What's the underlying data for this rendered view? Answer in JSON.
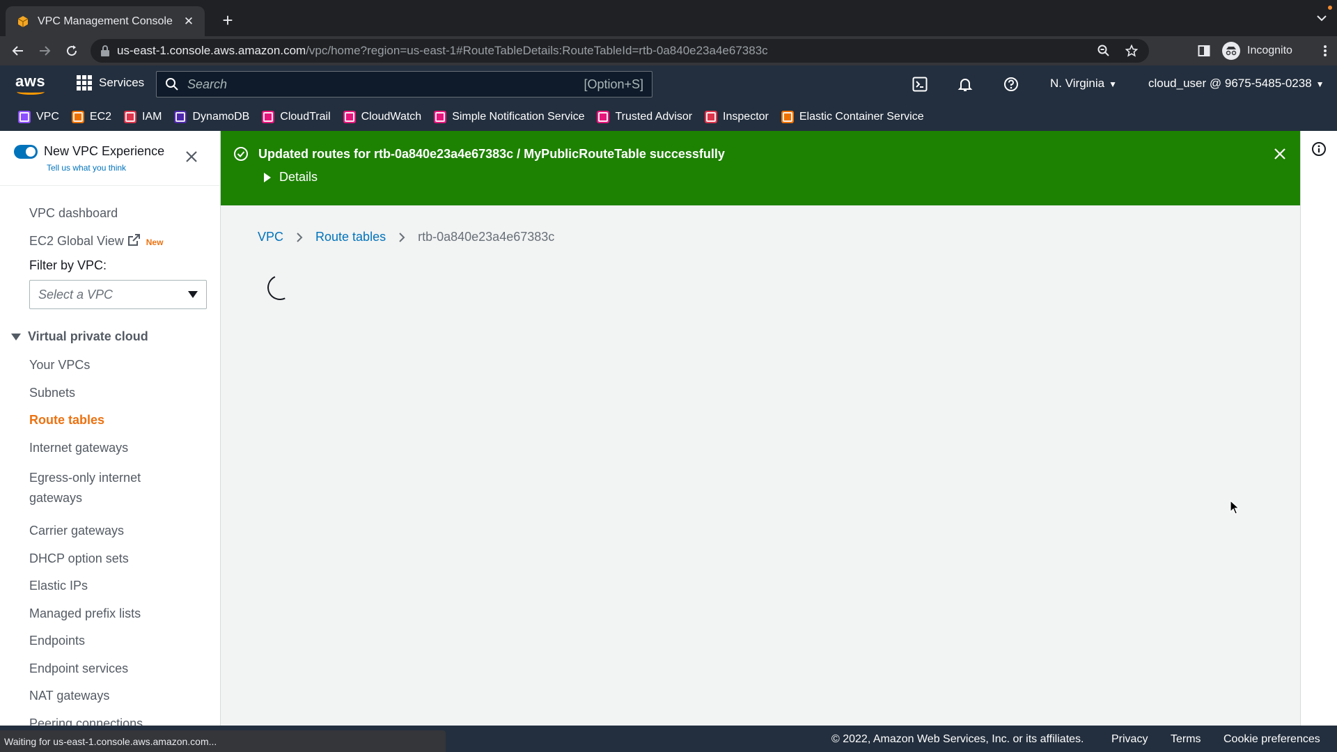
{
  "browser": {
    "tab_title": "VPC Management Console",
    "url_host": "us-east-1.console.aws.amazon.com",
    "url_path": "/vpc/home?region=us-east-1#RouteTableDetails:RouteTableId=rtb-0a840e23a4e67383c",
    "profile_label": "Incognito",
    "status_text": "Waiting for us-east-1.console.aws.amazon.com..."
  },
  "aws_header": {
    "logo": "aws",
    "services_label": "Services",
    "search_placeholder": "Search",
    "search_shortcut": "[Option+S]",
    "region": "N. Virginia",
    "account": "cloud_user @ 9675-5485-0238"
  },
  "favorites": [
    {
      "label": "VPC",
      "color": "#8c4fff"
    },
    {
      "label": "EC2",
      "color": "#ed7100"
    },
    {
      "label": "IAM",
      "color": "#dd344c"
    },
    {
      "label": "DynamoDB",
      "color": "#4d27aa"
    },
    {
      "label": "CloudTrail",
      "color": "#e7157b"
    },
    {
      "label": "CloudWatch",
      "color": "#e7157b"
    },
    {
      "label": "Simple Notification Service",
      "color": "#e7157b"
    },
    {
      "label": "Trusted Advisor",
      "color": "#e7157b"
    },
    {
      "label": "Inspector",
      "color": "#dd344c"
    },
    {
      "label": "Elastic Container Service",
      "color": "#ed7100"
    }
  ],
  "sidebar": {
    "experience_title": "New VPC Experience",
    "experience_link": "Tell us what you think",
    "top_links": {
      "dashboard": "VPC dashboard",
      "global_view": "EC2 Global View",
      "new_badge": "New"
    },
    "filter_label": "Filter by VPC:",
    "filter_value": "Select a VPC",
    "section_title": "Virtual private cloud",
    "items": {
      "your_vpcs": "Your VPCs",
      "subnets": "Subnets",
      "route_tables": "Route tables",
      "internet_gateways": "Internet gateways",
      "egress_line1": "Egress-only internet",
      "egress_line2": "gateways",
      "carrier_gateways": "Carrier gateways",
      "dhcp": "DHCP option sets",
      "elastic_ips": "Elastic IPs",
      "prefix_lists": "Managed prefix lists",
      "endpoints": "Endpoints",
      "endpoint_services": "Endpoint services",
      "nat_gateways": "NAT gateways",
      "peering": "Peering connections"
    }
  },
  "flash": {
    "message": "Updated routes for rtb-0a840e23a4e67383c / MyPublicRouteTable successfully",
    "details_label": "Details",
    "color": "#1d8102"
  },
  "breadcrumb": {
    "root": "VPC",
    "parent": "Route tables",
    "current": "rtb-0a840e23a4e67383c"
  },
  "footer": {
    "copyright": "© 2022, Amazon Web Services, Inc. or its affiliates.",
    "privacy": "Privacy",
    "terms": "Terms",
    "cookies": "Cookie preferences"
  }
}
